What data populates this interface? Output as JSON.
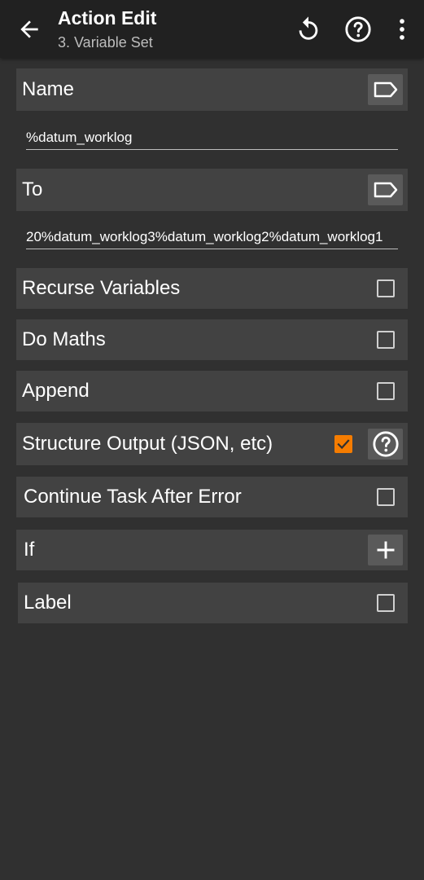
{
  "header": {
    "title": "Action Edit",
    "subtitle": "3. Variable Set",
    "back_icon": "arrow-back-icon",
    "undo_icon": "undo-icon",
    "help_icon": "help-circle-icon",
    "more_icon": "more-vert-icon"
  },
  "name_section": {
    "label": "Name",
    "value": "%datum_worklog",
    "tag_icon": "label-tag-icon"
  },
  "to_section": {
    "label": "To",
    "value": "20%datum_worklog3%datum_worklog2%datum_worklog1",
    "tag_icon": "label-tag-icon"
  },
  "options": {
    "recurse": {
      "label": "Recurse Variables",
      "checked": false
    },
    "maths": {
      "label": "Do Maths",
      "checked": false
    },
    "append": {
      "label": "Append",
      "checked": false
    },
    "structure": {
      "label": "Structure Output (JSON, etc)",
      "checked": true
    },
    "continue": {
      "label": "Continue Task After Error",
      "checked": false
    },
    "if": {
      "label": "If"
    },
    "label": {
      "label": "Label",
      "checked": false
    }
  },
  "colors": {
    "background": "#303030",
    "appbar": "#212121",
    "row": "#424242",
    "accent": "#f57c00"
  }
}
